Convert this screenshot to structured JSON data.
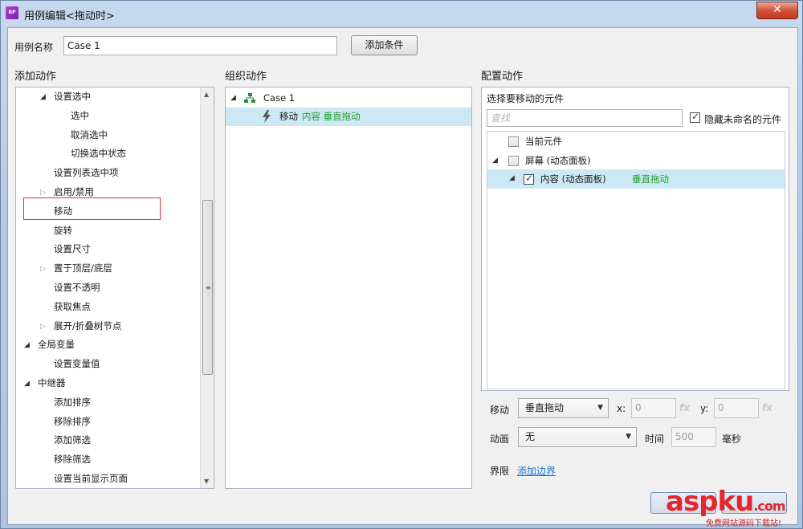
{
  "window": {
    "title": "用例编辑<拖动时>",
    "app_icon_text": "RP",
    "close_label": "✕"
  },
  "case": {
    "name_label": "用例名称",
    "name_value": "Case 1",
    "add_condition_label": "添加条件"
  },
  "columns": {
    "add_action": "添加动作",
    "organize_action": "组织动作",
    "configure_action": "配置动作"
  },
  "action_tree": [
    {
      "label": "设置选中",
      "level": 1,
      "expander": "open"
    },
    {
      "label": "选中",
      "level": 2
    },
    {
      "label": "取消选中",
      "level": 2
    },
    {
      "label": "切换选中状态",
      "level": 2
    },
    {
      "label": "设置列表选中项",
      "level": 1
    },
    {
      "label": "启用/禁用",
      "level": 1,
      "expander": "closed"
    },
    {
      "label": "移动",
      "level": 1,
      "highlighted": true
    },
    {
      "label": "旋转",
      "level": 1
    },
    {
      "label": "设置尺寸",
      "level": 1
    },
    {
      "label": "置于顶层/底层",
      "level": 1,
      "expander": "closed"
    },
    {
      "label": "设置不透明",
      "level": 1
    },
    {
      "label": "获取焦点",
      "level": 1
    },
    {
      "label": "展开/折叠树节点",
      "level": 1,
      "expander": "closed"
    },
    {
      "label": "全局变量",
      "level": 0,
      "expander": "open"
    },
    {
      "label": "设置变量值",
      "level": 1
    },
    {
      "label": "中继器",
      "level": 0,
      "expander": "open"
    },
    {
      "label": "添加排序",
      "level": 1
    },
    {
      "label": "移除排序",
      "level": 1
    },
    {
      "label": "添加筛选",
      "level": 1
    },
    {
      "label": "移除筛选",
      "level": 1
    },
    {
      "label": "设置当前显示页面",
      "level": 1
    }
  ],
  "organize": {
    "case_label": "Case 1",
    "action_prefix": "移动",
    "action_target": "内容 垂直拖动"
  },
  "configure": {
    "select_widget_label": "选择要移动的元件",
    "search_placeholder": "查找",
    "hide_unnamed_label": "隐藏未命名的元件",
    "hide_unnamed_checked": true,
    "widgets": [
      {
        "label": "当前元件",
        "checked": false
      },
      {
        "label": "屏幕 (动态面板)",
        "checked": false,
        "expander": "open"
      },
      {
        "label": "内容 (动态面板)",
        "suffix": "垂直拖动",
        "checked": true,
        "expander": "open",
        "selected": true
      }
    ],
    "move_label": "移动",
    "move_value": "垂直拖动",
    "x_label": "x:",
    "x_value": "0",
    "y_label": "y:",
    "y_value": "0",
    "fx_label": "fx",
    "animation_label": "动画",
    "animation_value": "无",
    "time_label": "时间",
    "time_value": "500",
    "time_unit": "毫秒",
    "bounds_label": "界限",
    "add_bounds_link": "添加边界"
  },
  "watermark": {
    "text": "aspku",
    "suffix": ".com",
    "subtitle": "免费网站源码下载站!"
  },
  "colors": {
    "selection": "#cce8f4",
    "green_text": "#22a12b",
    "highlight_border": "#e0302f",
    "link": "#1a74c9"
  }
}
